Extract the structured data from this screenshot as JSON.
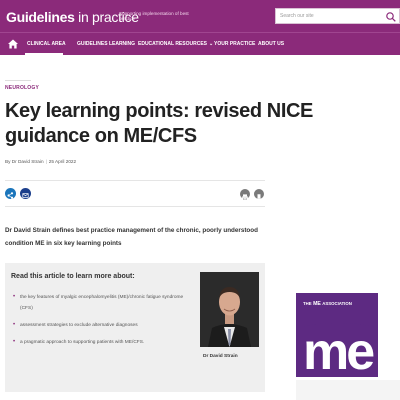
{
  "header": {
    "logo_main": "Guidelines",
    "logo_light": " in practice",
    "tagline": "Supporting implementation of best practice",
    "search_placeholder": "Search our site"
  },
  "nav": {
    "items": [
      {
        "label": "CLINICAL AREA",
        "active": true
      },
      {
        "label": "GUIDELINES LEARNING",
        "active": false
      },
      {
        "label": "EDUCATIONAL RESOURCES",
        "active": false,
        "has_dropdown": true
      },
      {
        "label": "YOUR PRACTICE",
        "active": false
      },
      {
        "label": "ABOUT US",
        "active": false
      }
    ]
  },
  "article": {
    "category": "NEUROLOGY",
    "title": "Key learning points: revised NICE guidance on ME/CFS",
    "author": "By Dr David Strain",
    "date": "25 April 2022",
    "lead": "Dr David Strain defines best practice management of the chronic, poorly understood condition ME in six key learning points"
  },
  "learn_box": {
    "title": "Read this article to learn more about:",
    "items": [
      "the key features of myalgic encephalomyelitis (ME)/chronic fatigue syndrome (CFS)",
      "assessment strategies to exclude alternative diagnoses",
      "a pragmatic approach to supporting patients with ME/CFS."
    ],
    "author_caption": "Dr David Strain"
  },
  "sidebar_ad": {
    "heading_pre": "THE",
    "heading_me": "ME",
    "heading_post": "ASSOCIATION",
    "mark": "me"
  },
  "colors": {
    "brand": "#8b2a7a",
    "ad_purple": "#5d2a82",
    "share_blue": "#1b75bb",
    "email_blue": "#1c3f8c"
  },
  "icons": [
    "home-icon",
    "search-icon",
    "share-icon",
    "email-icon",
    "print-icon",
    "bookmark-icon"
  ]
}
